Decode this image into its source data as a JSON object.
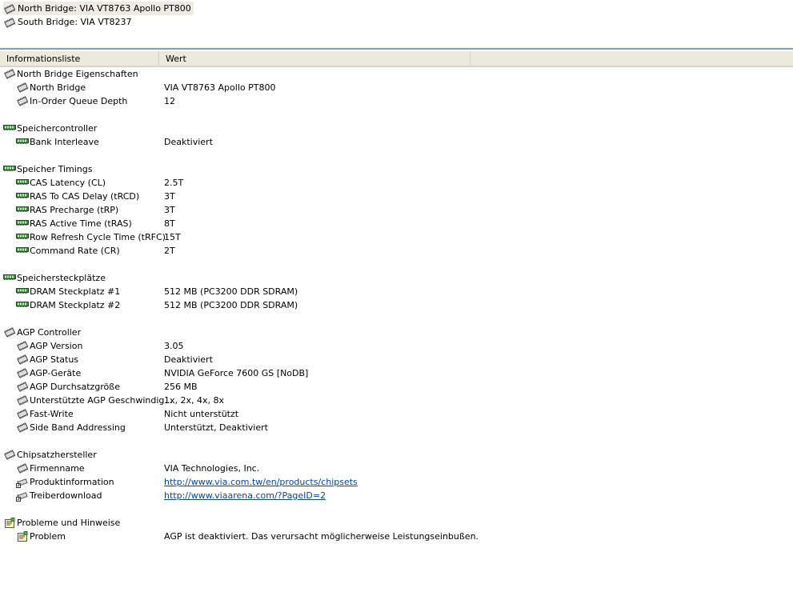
{
  "tree": [
    {
      "label": "North Bridge: VIA VT8763 Apollo PT800",
      "icon": "chip-icon",
      "selected": true
    },
    {
      "label": "South Bridge: VIA VT8237",
      "icon": "chip-icon",
      "selected": false
    }
  ],
  "columns": [
    "Informationsliste",
    "Wert"
  ],
  "rows": [
    {
      "type": "group",
      "icon": "chip-icon",
      "label": "North Bridge Eigenschaften",
      "value": ""
    },
    {
      "type": "item",
      "icon": "chip-icon",
      "label": "North Bridge",
      "value": "VIA VT8763 Apollo PT800"
    },
    {
      "type": "item",
      "icon": "chip-icon",
      "label": "In-Order Queue Depth",
      "value": "12"
    },
    {
      "type": "blank"
    },
    {
      "type": "group",
      "icon": "ram-icon",
      "label": "Speichercontroller",
      "value": ""
    },
    {
      "type": "item",
      "icon": "ram-icon",
      "label": "Bank Interleave",
      "value": "Deaktiviert"
    },
    {
      "type": "blank"
    },
    {
      "type": "group",
      "icon": "ram-icon",
      "label": "Speicher Timings",
      "value": ""
    },
    {
      "type": "item",
      "icon": "ram-icon",
      "label": "CAS Latency (CL)",
      "value": "2.5T"
    },
    {
      "type": "item",
      "icon": "ram-icon",
      "label": "RAS To CAS Delay (tRCD)",
      "value": "3T"
    },
    {
      "type": "item",
      "icon": "ram-icon",
      "label": "RAS Precharge (tRP)",
      "value": "3T"
    },
    {
      "type": "item",
      "icon": "ram-icon",
      "label": "RAS Active Time (tRAS)",
      "value": "8T"
    },
    {
      "type": "item",
      "icon": "ram-icon",
      "label": "Row Refresh Cycle Time (tRFC)",
      "value": "15T"
    },
    {
      "type": "item",
      "icon": "ram-icon",
      "label": "Command Rate (CR)",
      "value": "2T"
    },
    {
      "type": "blank"
    },
    {
      "type": "group",
      "icon": "ram-icon",
      "label": "Speichersteckplätze",
      "value": ""
    },
    {
      "type": "item",
      "icon": "ram-icon",
      "label": "DRAM Steckplatz #1",
      "value": "512 MB  (PC3200 DDR SDRAM)"
    },
    {
      "type": "item",
      "icon": "ram-icon",
      "label": "DRAM Steckplatz #2",
      "value": "512 MB  (PC3200 DDR SDRAM)"
    },
    {
      "type": "blank"
    },
    {
      "type": "group",
      "icon": "chip-icon",
      "label": "AGP Controller",
      "value": ""
    },
    {
      "type": "item",
      "icon": "chip-icon",
      "label": "AGP Version",
      "value": "3.05"
    },
    {
      "type": "item",
      "icon": "chip-icon",
      "label": "AGP Status",
      "value": "Deaktiviert"
    },
    {
      "type": "item",
      "icon": "chip-icon",
      "label": "AGP-Geräte",
      "value": "NVIDIA GeForce 7600 GS [NoDB]"
    },
    {
      "type": "item",
      "icon": "chip-icon",
      "label": "AGP Durchsatzgröße",
      "value": "256 MB"
    },
    {
      "type": "item",
      "icon": "chip-icon",
      "label": "Unterstützte AGP Geschwindig...",
      "value": "1x, 2x, 4x, 8x"
    },
    {
      "type": "item",
      "icon": "chip-icon",
      "label": "Fast-Write",
      "value": "Nicht unterstützt"
    },
    {
      "type": "item",
      "icon": "chip-icon",
      "label": "Side Band Addressing",
      "value": "Unterstützt, Deaktiviert"
    },
    {
      "type": "blank"
    },
    {
      "type": "group",
      "icon": "chip-icon",
      "label": "Chipsatzhersteller",
      "value": ""
    },
    {
      "type": "item",
      "icon": "chip-icon",
      "label": "Firmenname",
      "value": "VIA Technologies, Inc."
    },
    {
      "type": "item",
      "icon": "link-chip-icon",
      "label": "Produktinformation",
      "value": "http://www.via.com.tw/en/products/chipsets",
      "link": true
    },
    {
      "type": "item",
      "icon": "link-chip-icon",
      "label": "Treiberdownload",
      "value": "http://www.viaarena.com/?PageID=2",
      "link": true
    },
    {
      "type": "blank"
    },
    {
      "type": "group",
      "icon": "note-icon",
      "label": "Probleme und Hinweise",
      "value": ""
    },
    {
      "type": "item",
      "icon": "note-icon",
      "label": "Problem",
      "value": "AGP ist deaktiviert. Das verursacht möglicherweise Leistungseinbußen."
    }
  ],
  "colors": {
    "link": "#0645ad",
    "selected_bg": "#ecebe4",
    "header_bg": "#ebeadb",
    "ram_green": "#2e7d32"
  }
}
